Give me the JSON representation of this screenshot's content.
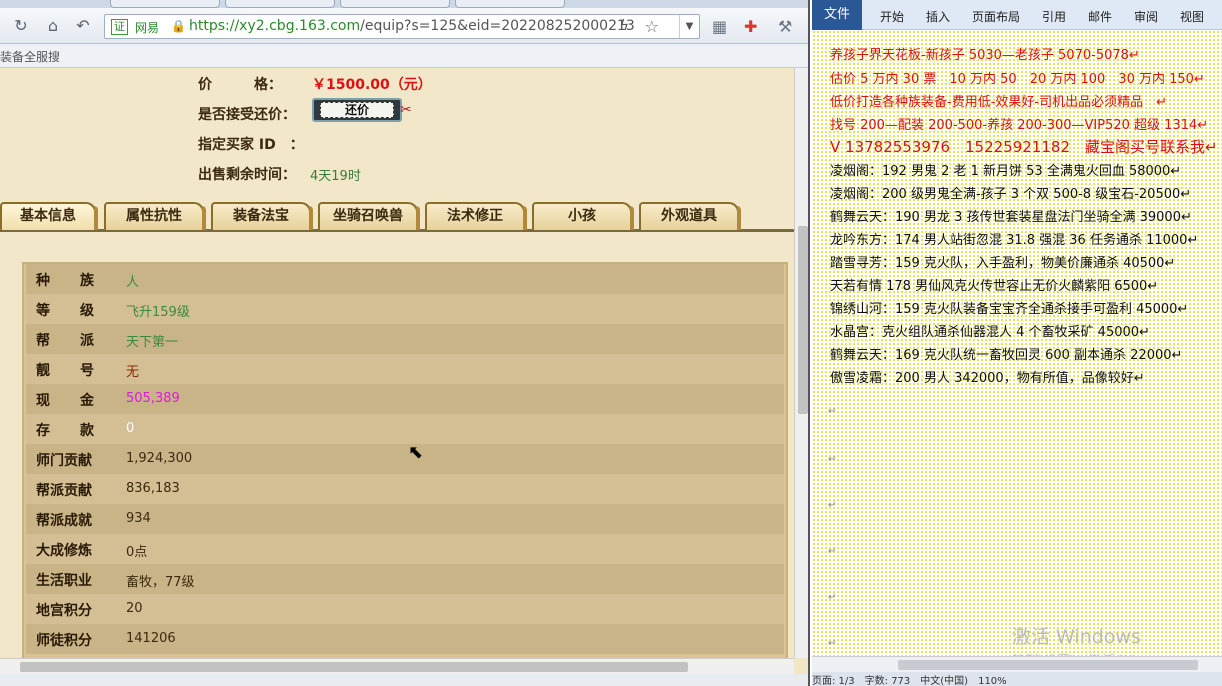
{
  "browser": {
    "cert_label": "证",
    "cert_name": "网易",
    "url_host": "https://xy2.cbg.163.com",
    "url_path": "/equip?s=125&eid=202208252000213",
    "fav_text": "装备全服搜"
  },
  "sale": {
    "price_label": "价　　　格：",
    "price_value": "￥1500.00（元）",
    "bargain_label": "是否接受还价：",
    "bargain_button": "还价",
    "buyer_label": "指定买家 ID　：",
    "time_label": "出售剩余时间：",
    "time_value": "4天19时"
  },
  "tabs": [
    {
      "label": "基本信息"
    },
    {
      "label": "属性抗性"
    },
    {
      "label": "装备法宝"
    },
    {
      "label": "坐骑召唤兽"
    },
    {
      "label": "法术修正"
    },
    {
      "label": "小孩"
    },
    {
      "label": "外观道具"
    }
  ],
  "info_rows": [
    {
      "label": "种族",
      "value": "人"
    },
    {
      "label": "等级",
      "value": "飞升159级"
    },
    {
      "label": "帮派",
      "value": "天下第一"
    },
    {
      "label": "靓号",
      "value": "无"
    },
    {
      "label": "现金",
      "value": "505,389"
    },
    {
      "label": "存款",
      "value": "0"
    },
    {
      "label": "师门贡献",
      "value": "1,924,300"
    },
    {
      "label": "帮派贡献",
      "value": "836,183"
    },
    {
      "label": "帮派成就",
      "value": "934"
    },
    {
      "label": "大成修炼",
      "value": "0点"
    },
    {
      "label": "生活职业",
      "value": "畜牧，77级"
    },
    {
      "label": "地宫积分",
      "value": "20"
    },
    {
      "label": "师徒积分",
      "value": "141206"
    }
  ],
  "word": {
    "ribbon_tabs": [
      "文件",
      "开始",
      "插入",
      "页面布局",
      "引用",
      "邮件",
      "审阅",
      "视图"
    ],
    "lines": [
      "养孩子界天花板-新孩子 5030—老孩子 5070-5078↵",
      "估价 5 万内 30 票　10 万内 50　20 万内 100　30 万内 150↵",
      "低价打造各种族装备-费用低-效果好-司机出品必须精品　↵",
      "找号 200—配装 200-500-养孩 200-300—VIP520 超级 1314↵",
      "V 13782553976　15225921182　藏宝阁买号联系我↵",
      "凌烟阁：192 男鬼 2 老 1 新月饼 53 全满鬼火回血 58000↵",
      "凌烟阁：200 级男鬼全满-孩子 3 个双 500-8 级宝石-20500↵",
      "鹤舞云天：190 男龙 3 孩传世套装星盘法门坐骑全满 39000↵",
      "龙吟东方：174 男人站街忽混 31.8 强混 36 任务通杀 11000↵",
      "踏雪寻芳：159 克火队，入手盈利，物美价廉通杀 40500↵",
      "天若有情 178 男仙风克火传世容止无价火麟紫阳 6500↵",
      "锦绣山河：159 克火队装备宝宝齐全通杀接手可盈利 45000↵",
      "水晶宫：克火组队通杀仙器混人 4 个畜牧采矿 45000↵",
      "鹤舞云天：169 克火队统一畜牧回灵 600 副本通杀 22000↵",
      "傲雪凌霜：200 男人 342000，物有所值，品像较好↵"
    ],
    "para_mark": "↵",
    "watermark_title": "激活 Windows",
    "watermark_sub": "转到\"设置\"以激活 Windows。",
    "status": "页面: 1/3　字数: 773　中文(中国)　110%"
  }
}
